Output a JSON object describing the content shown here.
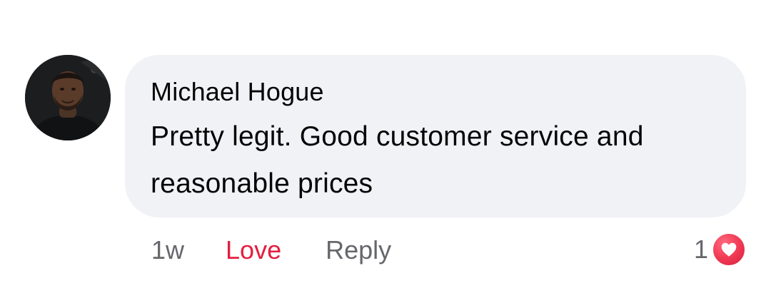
{
  "comment": {
    "author": "Michael Hogue",
    "avatar_alt": "Michael Hogue profile picture",
    "text": "Pretty legit. Good customer service and reasonable prices",
    "timestamp": "1w",
    "reaction_button_label": "Love",
    "reply_label": "Reply",
    "reaction_count": "1",
    "reaction_icon": "heart-icon"
  },
  "colors": {
    "bubble_background": "#f0f2f5",
    "text_primary": "#050505",
    "text_secondary": "#65676b",
    "love_red": "#e41e3f"
  }
}
